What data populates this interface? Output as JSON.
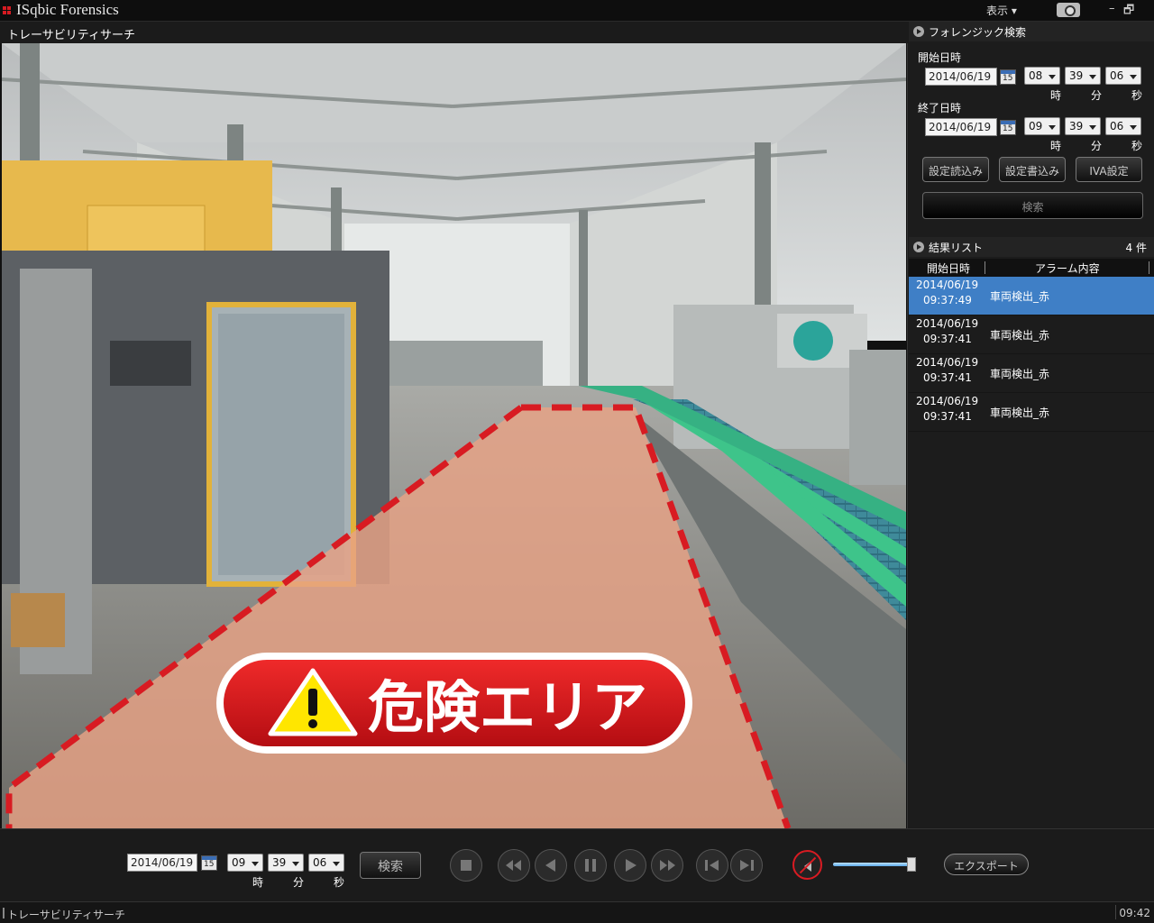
{
  "app": {
    "title": "ISqbic Forensics"
  },
  "titlebar": {
    "view_menu": "表示 ▾",
    "minimize": "–",
    "restore": "🗗"
  },
  "video": {
    "title": "トレーサビリティサーチ",
    "danger_label": "危険エリア",
    "colors": {
      "danger_red": "#d81b22",
      "zone_fill": "#e8a285"
    }
  },
  "forensic": {
    "title": "フォレンジック検索",
    "start_label": "開始日時",
    "end_label": "終了日時",
    "start": {
      "date": "2014/06/19",
      "hour": "08",
      "minute": "39",
      "second": "06"
    },
    "end": {
      "date": "2014/06/19",
      "hour": "09",
      "minute": "39",
      "second": "06"
    },
    "unit_hour": "時",
    "unit_minute": "分",
    "unit_second": "秒",
    "calendar_day": "15",
    "btn_load": "設定読込み",
    "btn_save": "設定書込み",
    "btn_iva": "IVA設定",
    "btn_search": "検索"
  },
  "results": {
    "title": "結果リスト",
    "count": "4 件",
    "col_start": "開始日時",
    "col_alarm": "アラーム内容",
    "rows": [
      {
        "date": "2014/06/19",
        "time": "09:37:49",
        "alarm": "車両検出_赤",
        "selected": true
      },
      {
        "date": "2014/06/19",
        "time": "09:37:41",
        "alarm": "車両検出_赤",
        "selected": false
      },
      {
        "date": "2014/06/19",
        "time": "09:37:41",
        "alarm": "車両検出_赤",
        "selected": false
      },
      {
        "date": "2014/06/19",
        "time": "09:37:41",
        "alarm": "車両検出_赤",
        "selected": false
      }
    ]
  },
  "playback": {
    "date": "2014/06/19",
    "hour": "09",
    "minute": "39",
    "second": "06",
    "unit_hour": "時",
    "unit_minute": "分",
    "unit_second": "秒",
    "search": "検索",
    "export": "エクスポート",
    "volume": 1.0,
    "icons": [
      "stop-icon",
      "fast-rewind-icon",
      "reverse-play-icon",
      "pause-icon",
      "play-icon",
      "fast-forward-icon",
      "step-back-icon",
      "step-forward-icon",
      "mute-icon"
    ]
  },
  "status": {
    "left": "トレーサビリティサーチ",
    "right": "09:42"
  },
  "colors": {
    "accent_blue": "#3f7fc6",
    "danger_red": "#d81b22"
  }
}
